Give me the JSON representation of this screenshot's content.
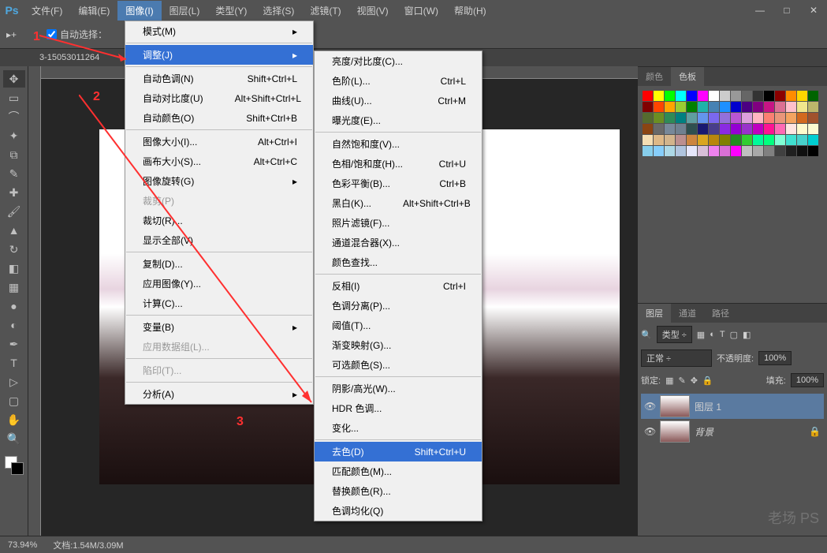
{
  "app": {
    "logo": "Ps"
  },
  "menubar": [
    "文件(F)",
    "编辑(E)",
    "图像(I)",
    "图层(L)",
    "类型(Y)",
    "选择(S)",
    "滤镜(T)",
    "视图(V)",
    "窗口(W)",
    "帮助(H)"
  ],
  "active_menu_index": 2,
  "options": {
    "auto_select": "自动选择："
  },
  "doc_tab": "3-15053011264",
  "annotations": {
    "one": "1",
    "two": "2",
    "three": "3"
  },
  "image_menu": {
    "mode": "模式(M)",
    "adjustments": "调整(J)",
    "auto_tone": {
      "label": "自动色调(N)",
      "shortcut": "Shift+Ctrl+L"
    },
    "auto_contrast": {
      "label": "自动对比度(U)",
      "shortcut": "Alt+Shift+Ctrl+L"
    },
    "auto_color": {
      "label": "自动颜色(O)",
      "shortcut": "Shift+Ctrl+B"
    },
    "image_size": {
      "label": "图像大小(I)...",
      "shortcut": "Alt+Ctrl+I"
    },
    "canvas_size": {
      "label": "画布大小(S)...",
      "shortcut": "Alt+Ctrl+C"
    },
    "image_rotation": "图像旋转(G)",
    "crop": "裁剪(P)",
    "trim": "裁切(R)...",
    "reveal_all": "显示全部(V)",
    "duplicate": "复制(D)...",
    "apply_image": "应用图像(Y)...",
    "calculations": "计算(C)...",
    "variables": "变量(B)",
    "apply_dataset": "应用数据组(L)...",
    "trap": "陷印(T)...",
    "analysis": "分析(A)"
  },
  "adjustments_submenu": {
    "brightness": "亮度/对比度(C)...",
    "levels": {
      "label": "色阶(L)...",
      "shortcut": "Ctrl+L"
    },
    "curves": {
      "label": "曲线(U)...",
      "shortcut": "Ctrl+M"
    },
    "exposure": "曝光度(E)...",
    "vibrance": "自然饱和度(V)...",
    "hue_sat": {
      "label": "色相/饱和度(H)...",
      "shortcut": "Ctrl+U"
    },
    "color_balance": {
      "label": "色彩平衡(B)...",
      "shortcut": "Ctrl+B"
    },
    "black_white": {
      "label": "黑白(K)...",
      "shortcut": "Alt+Shift+Ctrl+B"
    },
    "photo_filter": "照片滤镜(F)...",
    "channel_mixer": "通道混合器(X)...",
    "color_lookup": "颜色查找...",
    "invert": {
      "label": "反相(I)",
      "shortcut": "Ctrl+I"
    },
    "posterize": "色调分离(P)...",
    "threshold": "阈值(T)...",
    "gradient_map": "渐变映射(G)...",
    "selective_color": "可选颜色(S)...",
    "shadows_highlights": "阴影/高光(W)...",
    "hdr_toning": "HDR 色调...",
    "variations": "变化...",
    "desaturate": {
      "label": "去色(D)",
      "shortcut": "Shift+Ctrl+U"
    },
    "match_color": "匹配颜色(M)...",
    "replace_color": "替换颜色(R)...",
    "equalize": "色调均化(Q)"
  },
  "panels": {
    "color_tab": "颜色",
    "swatches_tab": "色板",
    "layers_tab": "图层",
    "channels_tab": "通道",
    "paths_tab": "路径",
    "kind_label": "类型",
    "blend_mode": "正常",
    "opacity_label": "不透明度:",
    "opacity_value": "100%",
    "lock_label": "锁定:",
    "fill_label": "填充:",
    "fill_value": "100%",
    "layer1": "图层 1",
    "background": "背景"
  },
  "statusbar": {
    "zoom": "73.94%",
    "doc_info": "文档:1.54M/3.09M"
  },
  "swatch_colors": [
    "#ff0000",
    "#ffff00",
    "#00ff00",
    "#00ffff",
    "#0000ff",
    "#ff00ff",
    "#ffffff",
    "#cccccc",
    "#999999",
    "#666666",
    "#333333",
    "#000000",
    "#8b0000",
    "#ff8c00",
    "#ffd700",
    "#006400",
    "#800000",
    "#ff4500",
    "#ffa500",
    "#9acd32",
    "#008000",
    "#20b2aa",
    "#4682b4",
    "#1e90ff",
    "#0000cd",
    "#4b0082",
    "#800080",
    "#c71585",
    "#db7093",
    "#ffc0cb",
    "#f0e68c",
    "#bdb76b",
    "#556b2f",
    "#6b8e23",
    "#2e8b57",
    "#008080",
    "#5f9ea0",
    "#6495ed",
    "#7b68ee",
    "#9370db",
    "#ba55d3",
    "#dda0dd",
    "#ffb6c1",
    "#fa8072",
    "#e9967a",
    "#f4a460",
    "#d2691e",
    "#a0522d",
    "#8b4513",
    "#696969",
    "#778899",
    "#708090",
    "#2f4f4f",
    "#191970",
    "#483d8b",
    "#8a2be2",
    "#9400d3",
    "#9932cc",
    "#c000c0",
    "#ff1493",
    "#ff69b4",
    "#ffe4e1",
    "#fffacd",
    "#fafad2",
    "#f5deb3",
    "#deb887",
    "#d2b48c",
    "#bc8f8f",
    "#cd853f",
    "#daa520",
    "#b8860b",
    "#808000",
    "#228b22",
    "#32cd32",
    "#00fa9a",
    "#00ff7f",
    "#7fffd4",
    "#40e0d0",
    "#48d1cc",
    "#00ced1",
    "#87ceeb",
    "#87cefa",
    "#add8e6",
    "#b0c4de",
    "#e6e6fa",
    "#d8bfd8",
    "#ee82ee",
    "#da70d6",
    "#ff00ff",
    "#c0c0c0",
    "#a9a9a9",
    "#808080",
    "#404040",
    "#202020",
    "#101010",
    "#000000"
  ],
  "watermark": "老场 PS"
}
